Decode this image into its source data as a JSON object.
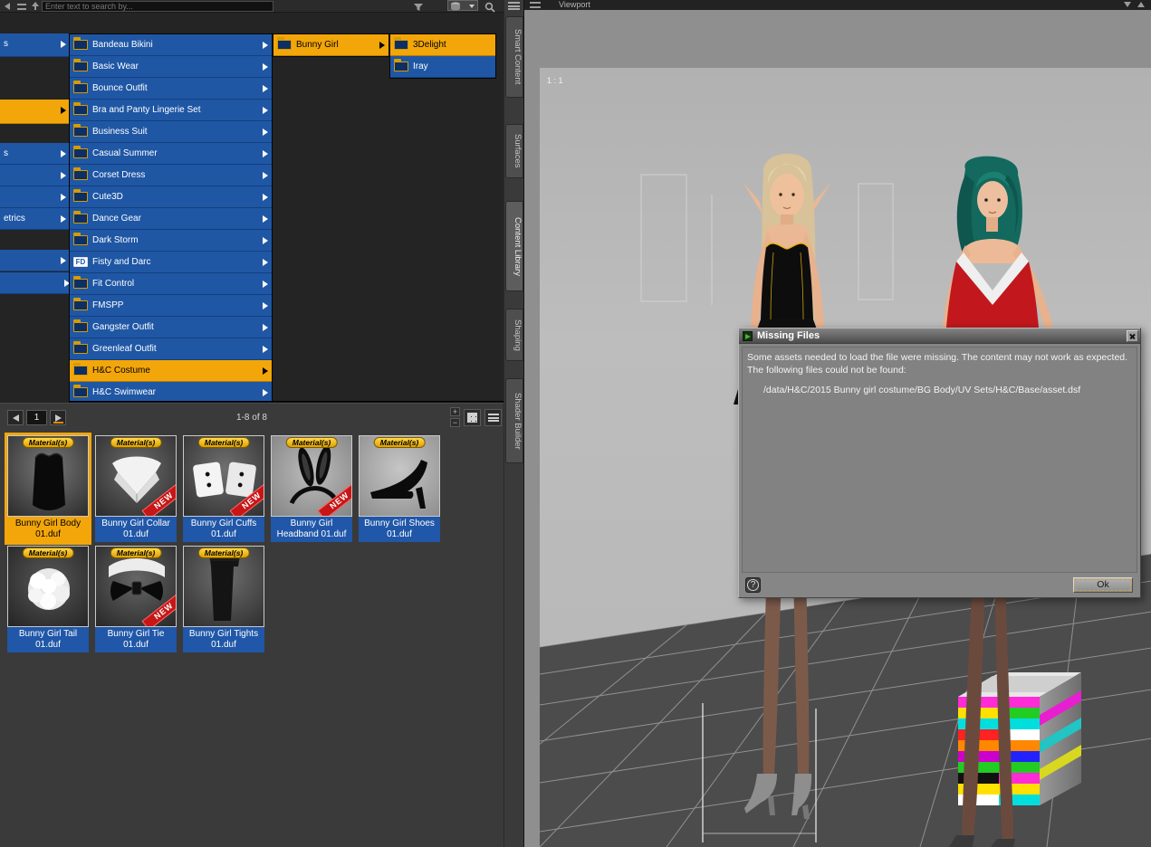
{
  "app": {
    "search_placeholder": "Enter text to search by...",
    "viewport_title": "Viewport",
    "aspect_label": "1 : 1"
  },
  "icons": {
    "fd_text": "FD"
  },
  "menu": {
    "col1": [
      {
        "label": "s"
      },
      {
        "label": ""
      },
      {
        "label": "s"
      },
      {
        "label": ""
      },
      {
        "label": ""
      },
      {
        "label": "etrics"
      },
      {
        "label": ""
      },
      {
        "label": ""
      }
    ],
    "col2": [
      {
        "label": "Bandeau Bikini"
      },
      {
        "label": "Basic Wear"
      },
      {
        "label": "Bounce Outfit"
      },
      {
        "label": "Bra and Panty Lingerie Set"
      },
      {
        "label": "Business Suit"
      },
      {
        "label": "Casual Summer"
      },
      {
        "label": "Corset Dress"
      },
      {
        "label": "Cute3D"
      },
      {
        "label": "Dance Gear"
      },
      {
        "label": "Dark Storm"
      },
      {
        "label": "Fisty and Darc"
      },
      {
        "label": "Fit Control"
      },
      {
        "label": "FMSPP"
      },
      {
        "label": "Gangster Outfit"
      },
      {
        "label": "Greenleaf Outfit"
      },
      {
        "label": "H&C Costume"
      },
      {
        "label": "H&C Swimwear"
      }
    ],
    "col3": [
      {
        "label": "Bunny Girl"
      }
    ],
    "col4": [
      {
        "label": "3Delight"
      },
      {
        "label": "Iray"
      }
    ]
  },
  "pagination": {
    "page": "1",
    "range_label": "1-8 of 8"
  },
  "thumbnails": [
    {
      "line1": "Bunny Girl Body",
      "line2": "01.duf",
      "badge": "Material(s)",
      "new_label": ""
    },
    {
      "line1": "Bunny Girl Collar",
      "line2": "01.duf",
      "badge": "Material(s)",
      "new_label": "NEW"
    },
    {
      "line1": "Bunny Girl Cuffs",
      "line2": "01.duf",
      "badge": "Material(s)",
      "new_label": "NEW"
    },
    {
      "line1": "Bunny Girl",
      "line2": "Headband 01.duf",
      "badge": "Material(s)",
      "new_label": "NEW"
    },
    {
      "line1": "Bunny Girl Shoes",
      "line2": "01.duf",
      "badge": "Material(s)",
      "new_label": ""
    },
    {
      "line1": "Bunny Girl Tail",
      "line2": "01.duf",
      "badge": "Material(s)",
      "new_label": ""
    },
    {
      "line1": "Bunny Girl Tie",
      "line2": "01.duf",
      "badge": "Material(s)",
      "new_label": "NEW"
    },
    {
      "line1": "Bunny Girl Tights",
      "line2": "01.duf",
      "badge": "Material(s)",
      "new_label": ""
    }
  ],
  "tabs": [
    {
      "label": "Smart Content"
    },
    {
      "label": "Surfaces"
    },
    {
      "label": "Content Library"
    },
    {
      "label": "Shaping"
    },
    {
      "label": "Shader Builder"
    }
  ],
  "dialog": {
    "title": "Missing Files",
    "message_line1": "Some assets needed to load the file were missing. The content may not work as expected.",
    "message_line2": "The following files could not be found:",
    "missing_file_path": "/data/H&C/2015 Bunny girl costume/BG Body/UV Sets/H&C/Base/asset.dsf",
    "help_label": "?",
    "ok_label": "Ok"
  },
  "colors": {
    "accent_yellow": "#f2a60a",
    "menu_blue": "#1f57a5",
    "new_red": "#c61616"
  }
}
